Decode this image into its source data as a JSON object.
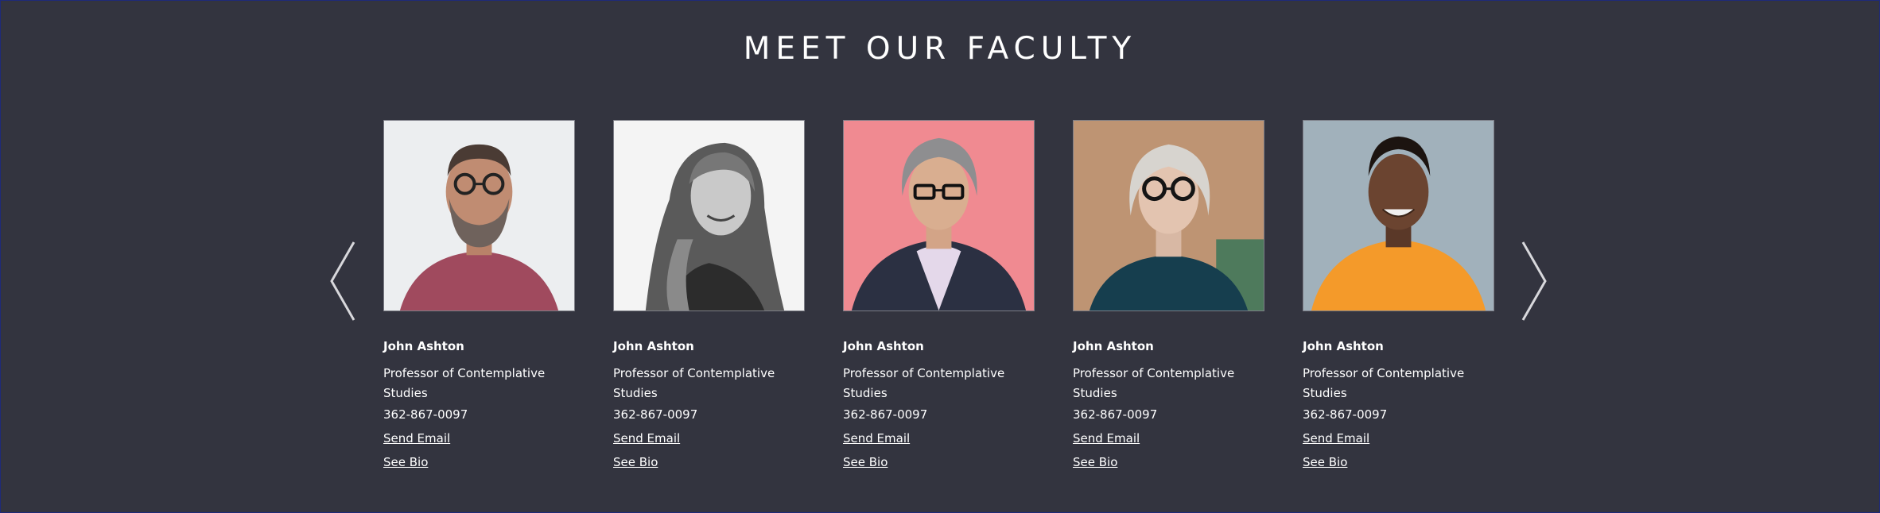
{
  "section": {
    "title": "MEET OUR FACULTY"
  },
  "carousel": {
    "prev_icon": "chevron-left-icon",
    "next_icon": "chevron-right-icon"
  },
  "faculty": [
    {
      "name": "John Ashton",
      "role": "Professor of Contemplative Studies",
      "phone": "362-867-0097",
      "email_label": "Send Email",
      "bio_label": "See Bio"
    },
    {
      "name": "John Ashton",
      "role": "Professor of Contemplative Studies",
      "phone": "362-867-0097",
      "email_label": "Send Email",
      "bio_label": "See Bio"
    },
    {
      "name": "John Ashton",
      "role": "Professor of Contemplative Studies",
      "phone": "362-867-0097",
      "email_label": "Send Email",
      "bio_label": "See Bio"
    },
    {
      "name": "John Ashton",
      "role": "Professor of Contemplative Studies",
      "phone": "362-867-0097",
      "email_label": "Send Email",
      "bio_label": "See Bio"
    },
    {
      "name": "John Ashton",
      "role": "Professor of Contemplative Studies",
      "phone": "362-867-0097",
      "email_label": "Send Email",
      "bio_label": "See Bio"
    }
  ],
  "colors": {
    "background": "#33343f",
    "text": "#ffffff",
    "photo_backgrounds": [
      "#e6e6e8",
      "#f2f2f2",
      "#f08b92",
      "#b88f6e",
      "#9fb0ba"
    ]
  }
}
